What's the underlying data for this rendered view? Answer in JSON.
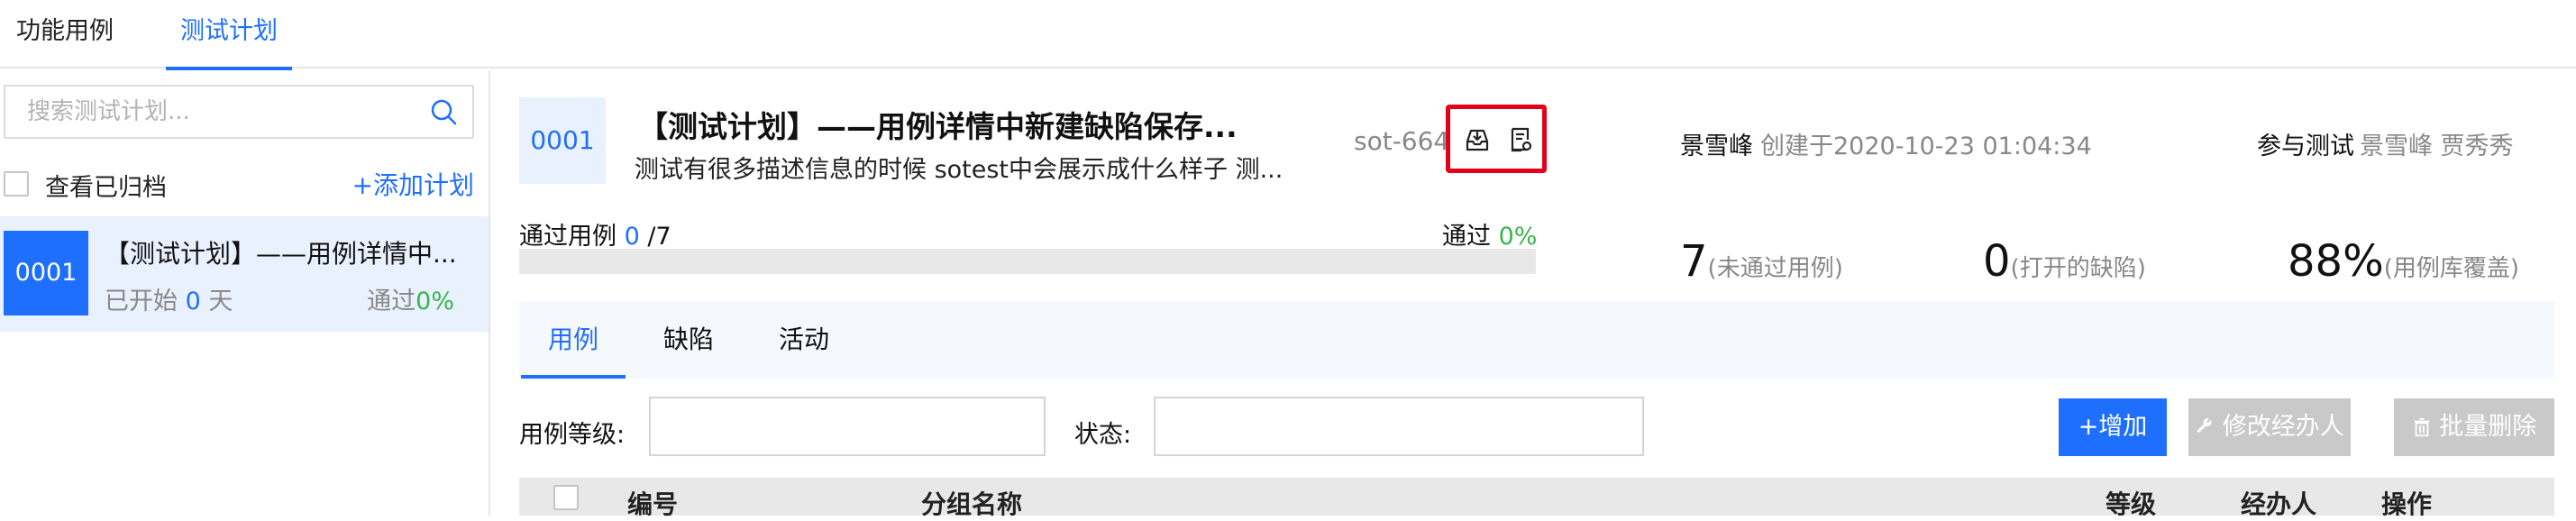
{
  "top_tabs": [
    {
      "label": "功能用例"
    },
    {
      "label": "测试计划"
    }
  ],
  "sidebar": {
    "search_placeholder": "搜索测试计划...",
    "archive_label": "查看已归档",
    "add_plan_label": "+添加计划",
    "plan": {
      "id": "0001",
      "title": "【测试计划】——用例详情中...",
      "started_prefix": "已开始",
      "started_days": "0",
      "started_suffix": "天",
      "pass_label": "通过",
      "pass_pct": "0%"
    }
  },
  "header": {
    "id": "0001",
    "title": "【测试计划】——用例详情中新建缺陷保存...",
    "subtitle": "测试有很多描述信息的时候 sotest中会展示成什么样子 测...",
    "code": "sot-664",
    "creator_name": "景雪峰",
    "created_text": "创建于2020-10-23 01:04:34",
    "participants_label": "参与测试",
    "participants": "景雪峰 贾秀秀"
  },
  "progress": {
    "pass_cases_label": "通过用例",
    "pass_cases_count": "0",
    "pass_cases_total": "/7",
    "pass_label": "通过",
    "pass_pct": "0%",
    "fraction": 0
  },
  "stats": [
    {
      "value": "7",
      "label": "(未通过用例)"
    },
    {
      "value": "0",
      "label": "(打开的缺陷)"
    },
    {
      "value": "88%",
      "label": "(用例库覆盖)"
    }
  ],
  "inner_tabs": [
    {
      "label": "用例"
    },
    {
      "label": "缺陷"
    },
    {
      "label": "活动"
    }
  ],
  "filters": {
    "level_label": "用例等级:",
    "status_label": "状态:"
  },
  "buttons": {
    "add": "+增加",
    "change_owner": "修改经办人",
    "batch_delete": "批量删除"
  },
  "table_headers": [
    "编号",
    "分组名称",
    "等级",
    "经办人",
    "操作"
  ],
  "colors": {
    "accent": "#1f6fff",
    "success": "#39b54a",
    "highlight": "#e4001b"
  }
}
